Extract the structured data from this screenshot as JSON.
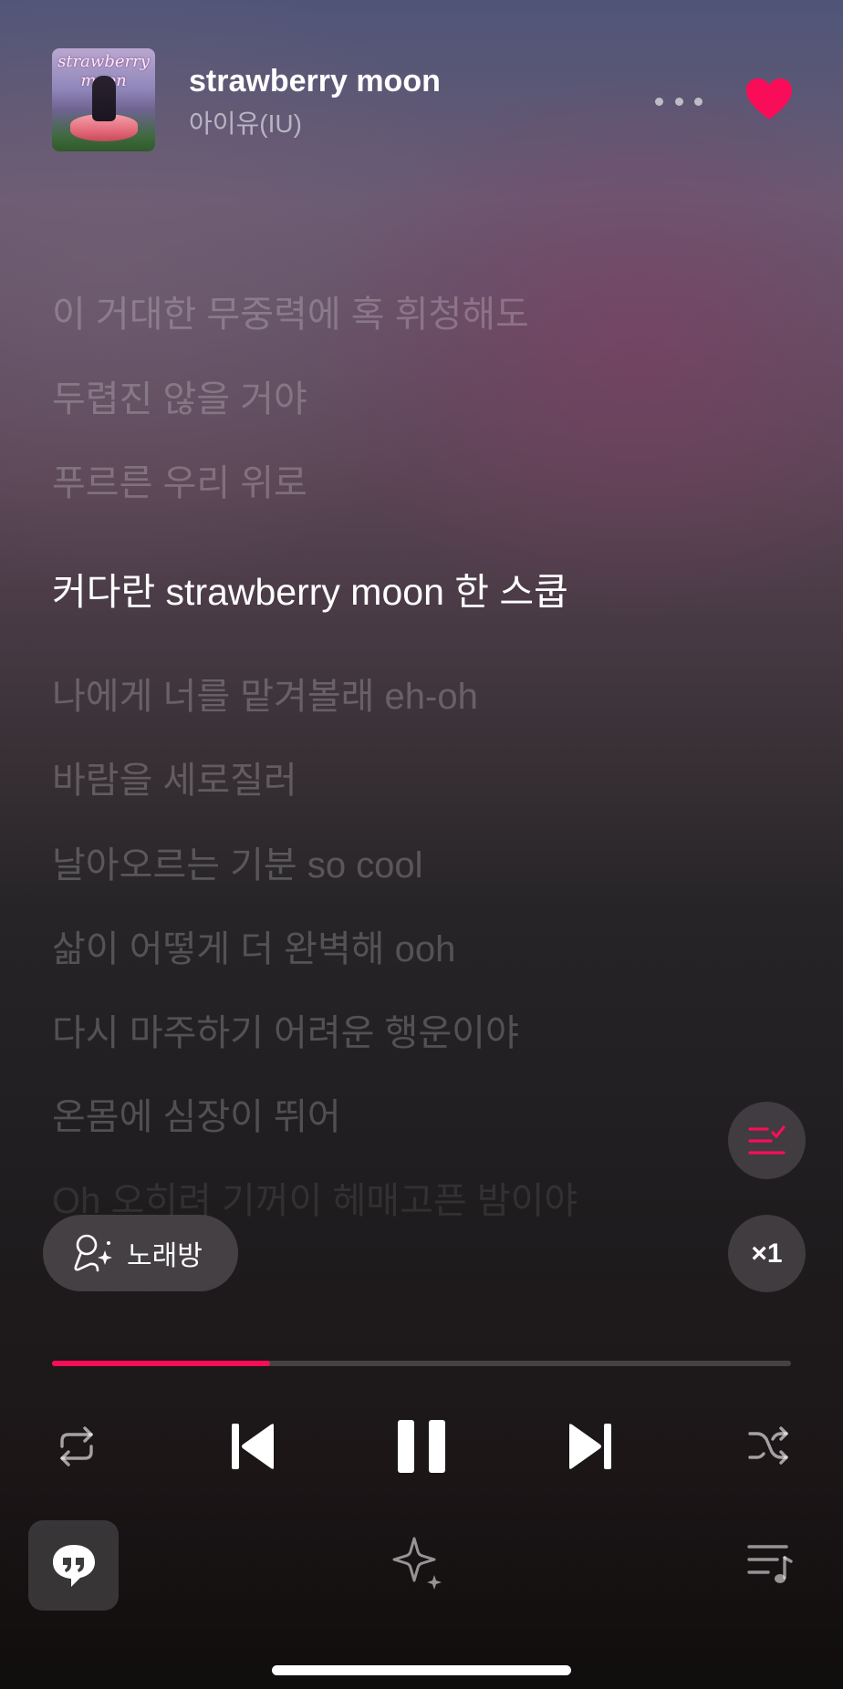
{
  "track": {
    "title": "strawberry moon",
    "artist": "아이유(IU)",
    "album_art_text": "strawberry moon",
    "liked": true
  },
  "lyrics": {
    "lines": [
      "이 거대한 무중력에 혹 휘청해도",
      "두렵진 않을 거야",
      "푸르른 우리 위로",
      "커다란 strawberry moon 한 스쿱",
      "나에게 너를 맡겨볼래 eh-oh",
      "바람을 세로질러",
      "날아오르는 기분 so cool",
      "삶이 어떻게 더 완벽해 ooh",
      "다시 마주하기 어려운 행운이야",
      "온몸에 심장이 뛰어",
      "Oh 오히려 기꺼이 헤매고픈 밤이야"
    ],
    "current_index": 3
  },
  "karaoke": {
    "label": "노래방"
  },
  "speed": {
    "label": "×1"
  },
  "playback": {
    "progress": 0.295,
    "state": "playing"
  },
  "icons": {
    "more": "more-icon",
    "like": "heart-icon",
    "lyrics_check": "lyrics-check-icon",
    "karaoke": "microphone-sparkle-icon",
    "repeat": "repeat-icon",
    "previous": "skip-previous-icon",
    "pause": "pause-icon",
    "next": "skip-next-icon",
    "shuffle": "shuffle-icon",
    "lyrics_mode": "quote-bubble-icon",
    "ai": "sparkle-icon",
    "queue": "playlist-icon"
  },
  "colors": {
    "accent": "#fa0d58",
    "text_primary": "#ffffff"
  }
}
